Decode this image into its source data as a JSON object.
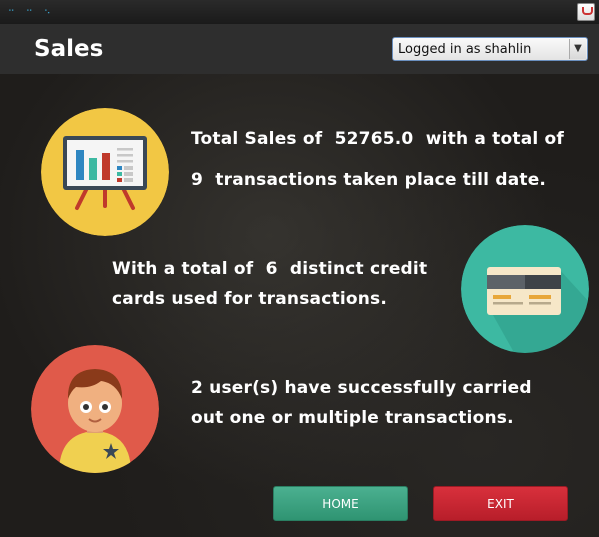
{
  "window": {
    "icon": "java-cup-icon"
  },
  "header": {
    "title": "Sales",
    "user_select_value": "Logged in as shahlin"
  },
  "stats": {
    "sales_line1_prefix": "Total Sales of",
    "total_sales": "52765.0",
    "sales_line1_suffix": "with a total of",
    "transactions_count": "9",
    "sales_line2_suffix": "transactions taken place till date.",
    "cards_line1_prefix": "With a total of",
    "cards_count": "6",
    "cards_line1_suffix": "distinct credit",
    "cards_line2": "cards used for transactions.",
    "users_line1": "2 user(s) have successfully carried",
    "users_line2": "out one or multiple transactions."
  },
  "buttons": {
    "home_label": "HOME",
    "exit_label": "EXIT"
  },
  "colors": {
    "chart_icon_bg": "#f2c744",
    "card_icon_bg": "#3db9a2",
    "user_icon_bg": "#e05a4a",
    "home_button": "#3aa583",
    "exit_button": "#c8232f"
  }
}
